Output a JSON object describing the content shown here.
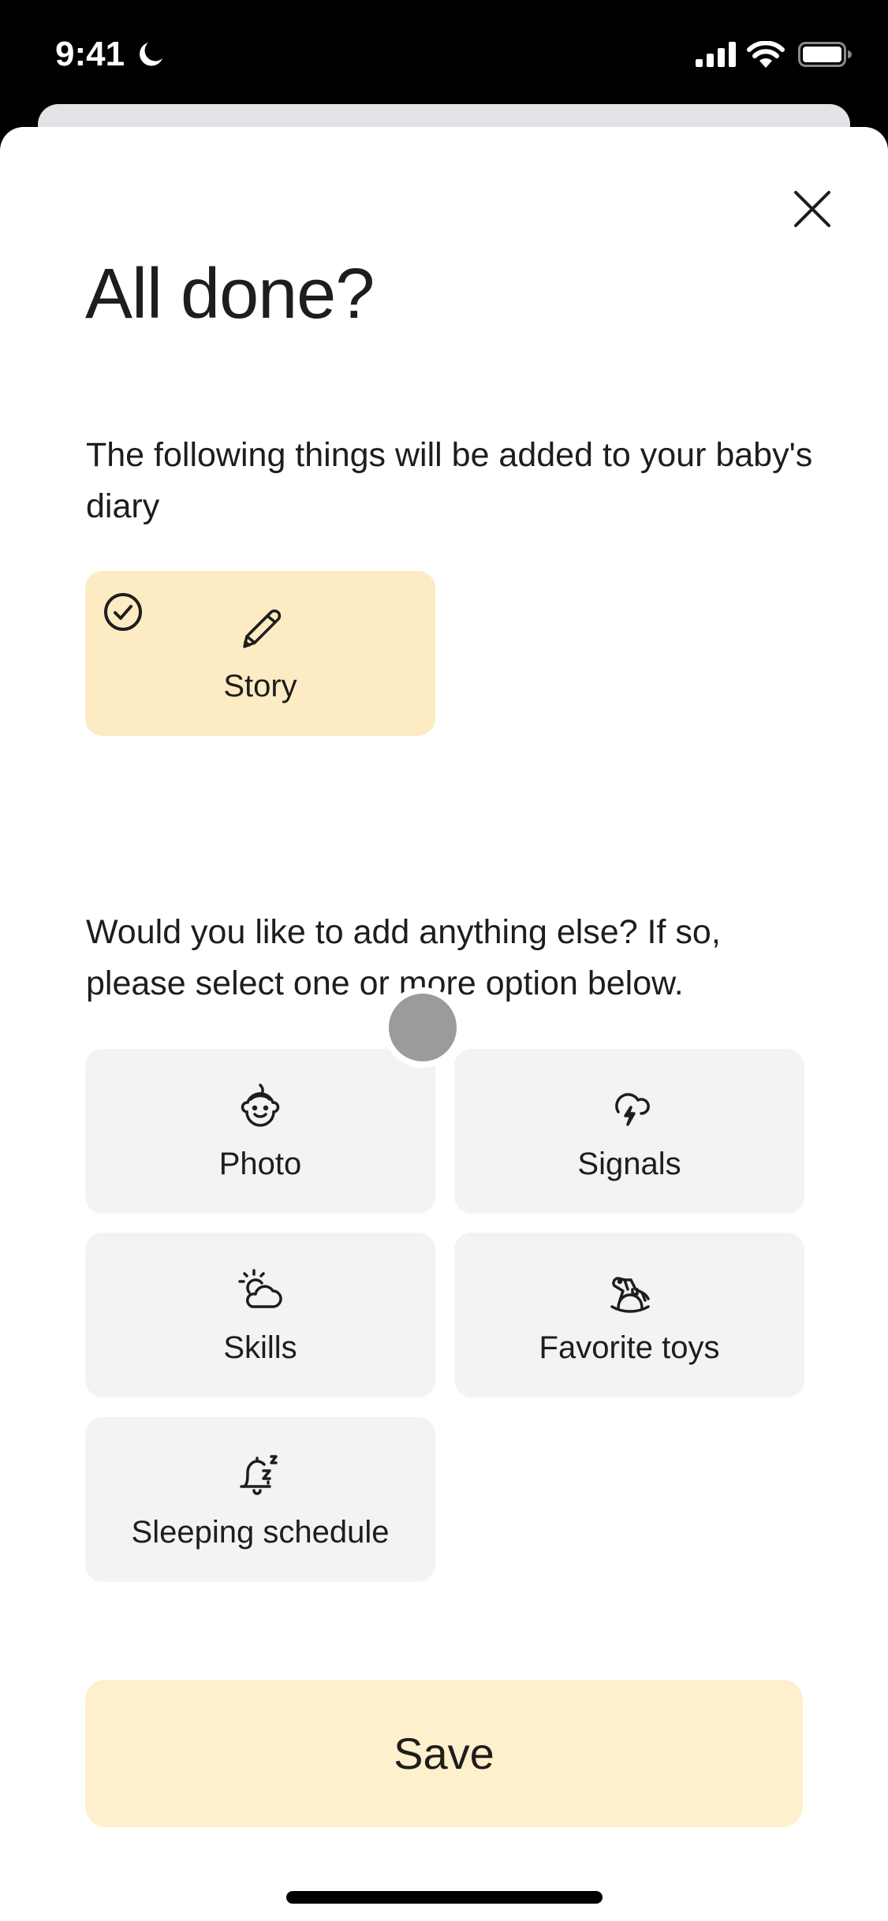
{
  "status_bar": {
    "time": "9:41",
    "focus_icon": "moon-icon",
    "signal_icon": "cellular-signal-icon",
    "wifi_icon": "wifi-icon",
    "battery_icon": "battery-icon"
  },
  "dialog": {
    "title": "All done?",
    "close_icon": "close-icon",
    "intro_text": "The following things will be added to your baby's diary",
    "selected_items": [
      {
        "label": "Story",
        "icon": "pencil-icon",
        "selected": true
      }
    ],
    "prompt_text": "Would you like to add anything else? If so, please select one or more option below.",
    "options": [
      {
        "label": "Photo",
        "icon": "baby-face-icon",
        "selected": false
      },
      {
        "label": "Signals",
        "icon": "cloud-lightning-icon",
        "selected": false
      },
      {
        "label": "Skills",
        "icon": "sun-cloud-icon",
        "selected": false
      },
      {
        "label": "Favorite toys",
        "icon": "rocking-horse-icon",
        "selected": false
      },
      {
        "label": "Sleeping schedule",
        "icon": "bell-sleep-icon",
        "selected": false
      }
    ],
    "save_label": "Save"
  },
  "colors": {
    "accent_selected": "#fdebc4",
    "save_button": "#fef0cc",
    "option_background": "#f3f2f5",
    "text": "#1f1d1c"
  }
}
